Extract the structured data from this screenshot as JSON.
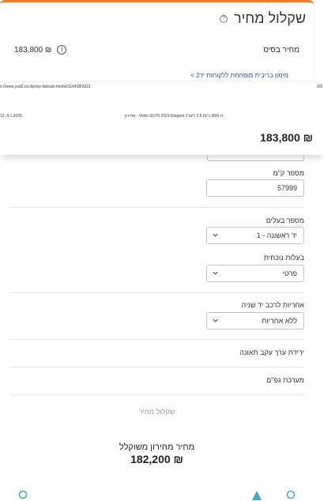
{
  "header": {
    "title": "שקלול מחיר",
    "help_icon": "help-icon"
  },
  "base_price": {
    "label": "מחיר בסיס",
    "value": "183,800 ₪",
    "icon": "info-icon"
  },
  "finance_link": "מימון בריבית מופחתת ללקוחות יד2 >",
  "print_header": {
    "url": "s://www.yad2.co.il/price-list/sub-model/116418/2021",
    "page": "2/5",
    "date": "12 ,4,1,2026",
    "doc_title": "מחירון - Volvo GV70 2021 Elegant 2ת (304 כ\"ס) 2,5 ליטר"
  },
  "price_bar": {
    "value": "183,800 ₪"
  },
  "form": {
    "km_label": "מספר ק\"מ",
    "km_value": "57999",
    "owners_label": "מספר בעלים",
    "owners_value": "1 - יד ראשונה",
    "ownership_label": "בעלות נוכחית",
    "ownership_value": "פרטי",
    "warranty_label": "אחריות לרכב יד שניה",
    "warranty_value": "ללא אחריות",
    "accident_label": "ירידת ערך עקב תאונה",
    "bodywork_label": "מערכת גפ\"ם",
    "calc_button": "שקלול מחיר",
    "final_label": "מחיר מחירון משוקלל",
    "final_value": "182,200 ₪"
  },
  "colors": {
    "accent": "#f07b2d",
    "link": "#2a4f8f",
    "bottom_icons": "#4aa3c0"
  }
}
